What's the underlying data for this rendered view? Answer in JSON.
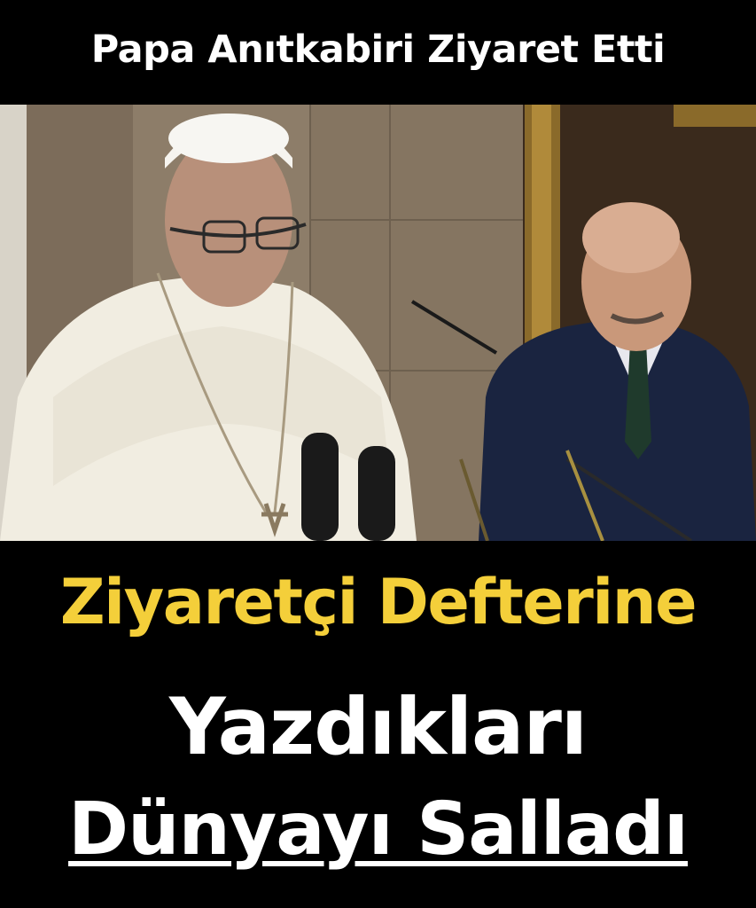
{
  "header": {
    "title": "Papa Anıtkabiri Ziyaret Etti"
  },
  "photo": {
    "subject": "photo-pope-at-microphones"
  },
  "headline": {
    "line1": "Ziyaretçi Defterine",
    "line2": "Yazdıkları",
    "line3": "Dünyayı Salladı"
  },
  "colors": {
    "background": "#000000",
    "accent_yellow": "#f4cf3a",
    "text_white": "#ffffff"
  }
}
